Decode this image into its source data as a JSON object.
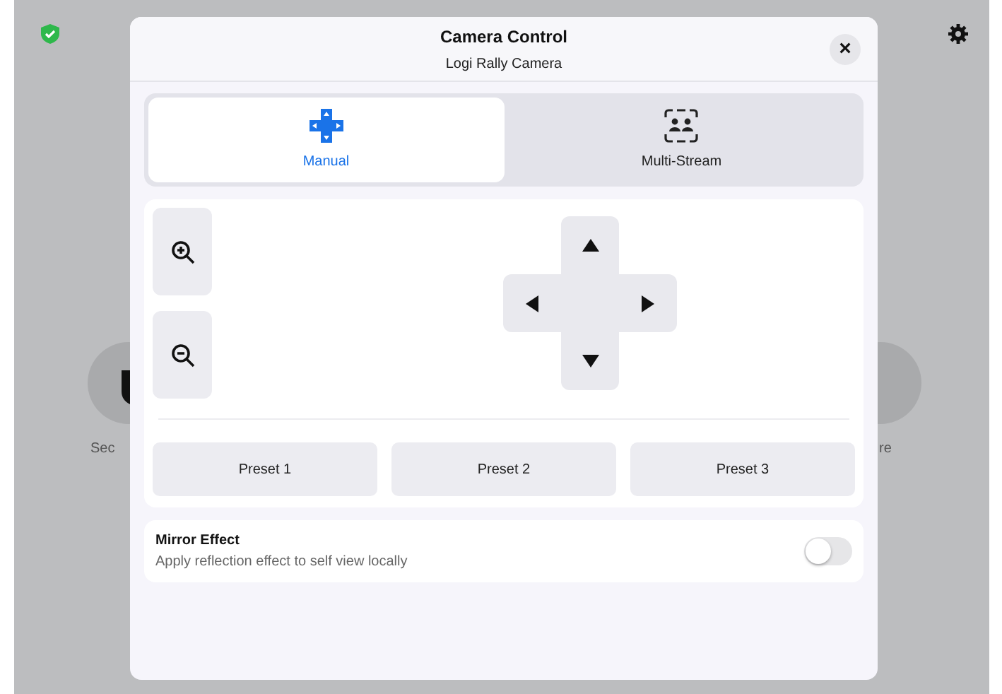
{
  "background": {
    "left_label": "Sec",
    "right_label": "re"
  },
  "dialog": {
    "title": "Camera Control",
    "subtitle": "Logi Rally Camera",
    "close": "×"
  },
  "tabs": [
    {
      "label": "Manual",
      "selected": true,
      "kind": "dpad"
    },
    {
      "label": "Multi-Stream",
      "selected": false,
      "kind": "people"
    }
  ],
  "presets": [
    "Preset 1",
    "Preset 2",
    "Preset 3"
  ],
  "mirror": {
    "title": "Mirror Effect",
    "description": "Apply reflection effect to self view locally",
    "on": false
  }
}
